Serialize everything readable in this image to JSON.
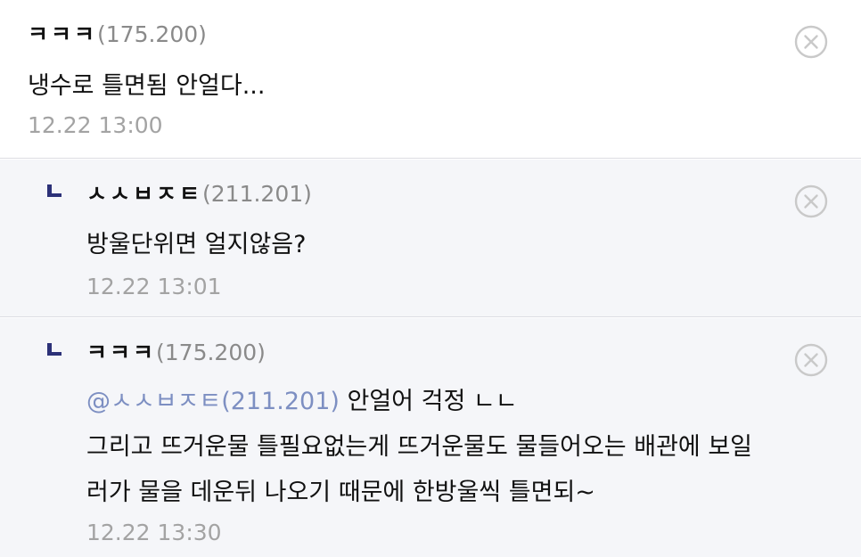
{
  "comments": [
    {
      "author": "ㅋㅋㅋ",
      "ip": "(175.200)",
      "lines": [
        "냉수로 틀면됨 안얼다..."
      ],
      "time": "12.22 13:00"
    },
    {
      "author": "ㅅㅅㅂㅈㅌ",
      "ip": "(211.201)",
      "lines": [
        "방울단위면 얼지않음?"
      ],
      "time": "12.22 13:01"
    },
    {
      "author": "ㅋㅋㅋ",
      "ip": "(175.200)",
      "mention": "@ㅅㅅㅂㅈㅌ(211.201)",
      "first_line_rest": " 안얼어 걱정 ㄴㄴ",
      "lines": [
        "그리고 뜨거운물 틀필요없는게 뜨거운물도 물들어오는 배관에 보일",
        "러가 물을 데운뒤 나오기 때문에 한방울씩 틀면되~"
      ],
      "time": "12.22 13:30"
    }
  ],
  "icons": {
    "delete": "close-circle-icon",
    "reply_marker": "reply-arrow-icon"
  },
  "colors": {
    "reply_marker": "#2c3178",
    "mention": "#7d8fc2",
    "reply_background": "#f5f6f9",
    "timestamp": "#a3a3a3"
  }
}
